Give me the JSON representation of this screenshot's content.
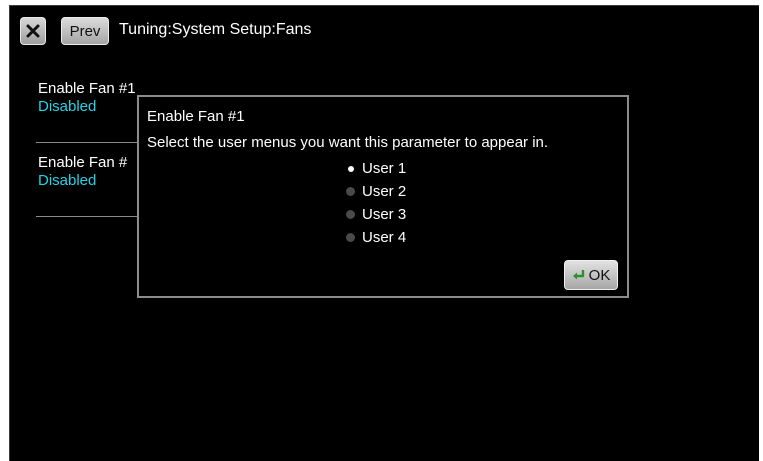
{
  "header": {
    "close_icon": "close-icon",
    "prev_label": "Prev",
    "breadcrumb": "Tuning:System Setup:Fans"
  },
  "parameters": [
    {
      "name": "Enable Fan #1",
      "value": "Disabled"
    },
    {
      "name": "Enable Fan #",
      "value": "Disabled"
    }
  ],
  "dialog": {
    "title": "Enable Fan #1",
    "message": "Select the user menus you want this parameter to appear in.",
    "options": [
      {
        "label": "User 1",
        "selected": true
      },
      {
        "label": "User 2",
        "selected": false
      },
      {
        "label": "User 3",
        "selected": false
      },
      {
        "label": "User 4",
        "selected": false
      }
    ],
    "ok_label": "OK",
    "ok_icon": "enter-return-icon"
  },
  "colors": {
    "background": "#000000",
    "value_text": "#22d4e6",
    "dialog_border": "#8c8c8c"
  }
}
